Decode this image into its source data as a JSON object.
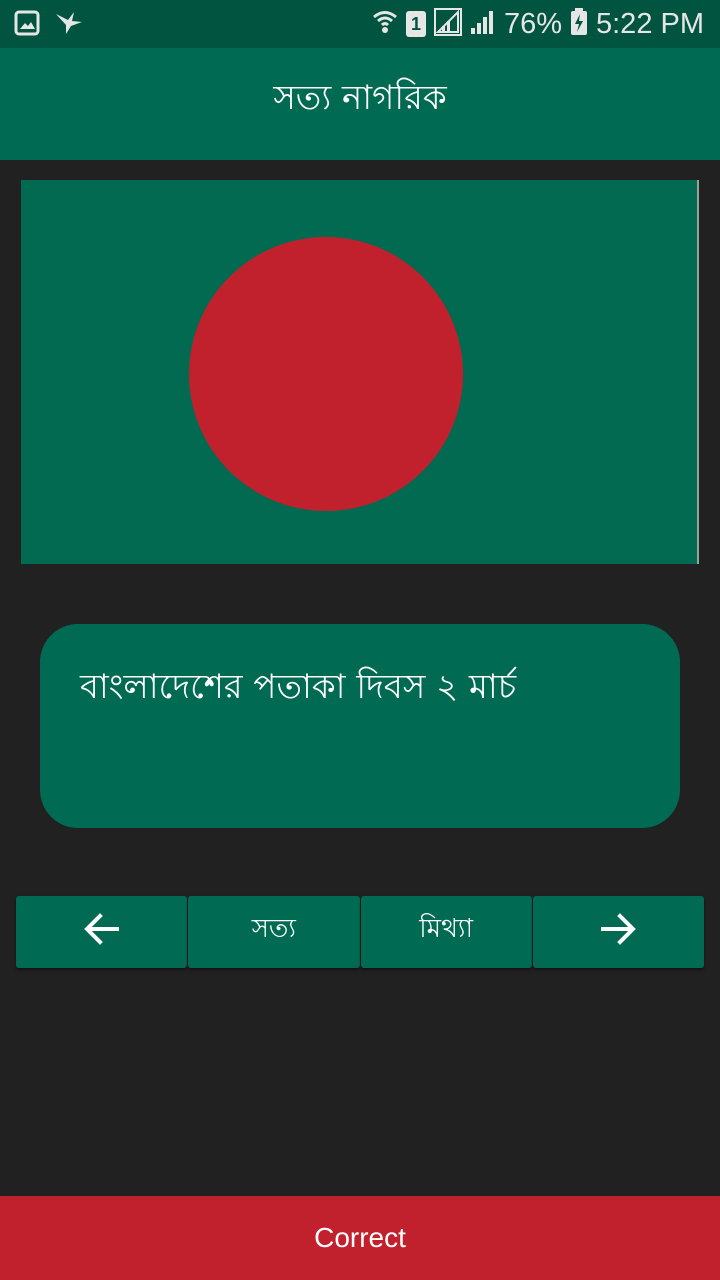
{
  "status_bar": {
    "signal_percent": "76%",
    "time": "5:22 PM",
    "sim_badge": "1",
    "icons": [
      "gallery-icon",
      "bird-notification-icon",
      "wifi-icon",
      "sim-1-icon",
      "signal-icon",
      "signal-icon",
      "battery-charging-icon"
    ]
  },
  "app_bar": {
    "title": "সত্য নাগরিক"
  },
  "flag": {
    "background": "#016a50",
    "disc": "#c0212d"
  },
  "question": {
    "text": "বাংলাদেশের পতাকা দিবস ২ মার্চ"
  },
  "buttons": {
    "prev_icon": "arrow-left-icon",
    "true_label": "সত্য",
    "false_label": "মিথ্যা",
    "next_icon": "arrow-right-icon"
  },
  "result": {
    "text": "Correct",
    "color": "#c0212d"
  },
  "colors": {
    "primary": "#006b52",
    "primary_dark": "#005440",
    "background": "#212121"
  }
}
